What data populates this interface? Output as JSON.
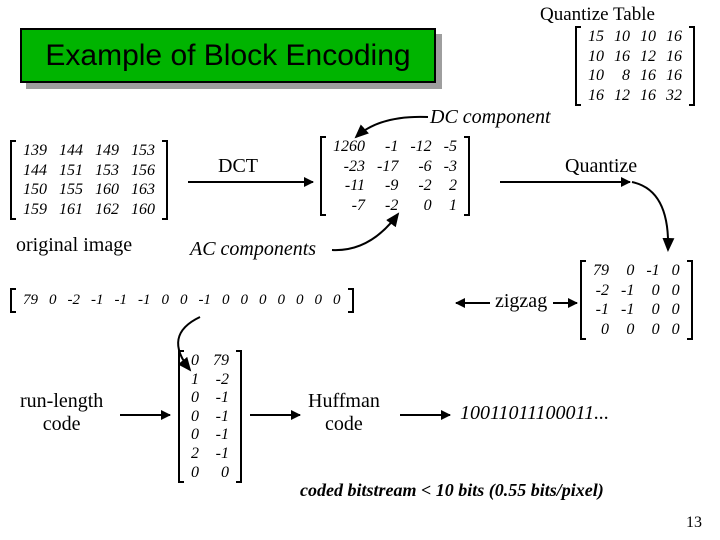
{
  "title": "Example of Block Encoding",
  "labels": {
    "quantize_table": "Quantize Table",
    "dc_component": "DC component",
    "dct": "DCT",
    "quantize": "Quantize",
    "original_image": "original image",
    "ac_components": "AC components",
    "zigzag": "zigzag",
    "run_length_code": "run-length\ncode",
    "huffman_code": "Huffman\ncode",
    "bitstream": "10011011100011...",
    "caption": "coded bitstream < 10 bits (0.55 bits/pixel)"
  },
  "page_number": "13",
  "matrices": {
    "quantize_table": [
      [
        "15",
        "10",
        "10",
        "16"
      ],
      [
        "10",
        "16",
        "12",
        "16"
      ],
      [
        "10",
        "8",
        "16",
        "16"
      ],
      [
        "16",
        "12",
        "16",
        "32"
      ]
    ],
    "original": [
      [
        "139",
        "144",
        "149",
        "153"
      ],
      [
        "144",
        "151",
        "153",
        "156"
      ],
      [
        "150",
        "155",
        "160",
        "163"
      ],
      [
        "159",
        "161",
        "162",
        "160"
      ]
    ],
    "dct_out": [
      [
        "1260",
        "-1",
        "-12",
        "-5"
      ],
      [
        "-23",
        "-17",
        "-6",
        "-3"
      ],
      [
        "-11",
        "-9",
        "-2",
        "2"
      ],
      [
        "-7",
        "-2",
        "0",
        "1"
      ]
    ],
    "quantized": [
      [
        "79",
        "0",
        "-1",
        "0"
      ],
      [
        "-2",
        "-1",
        "0",
        "0"
      ],
      [
        "-1",
        "-1",
        "0",
        "0"
      ],
      [
        "0",
        "0",
        "0",
        "0"
      ]
    ],
    "zigzag_row": [
      [
        "79",
        "0",
        "-2",
        "-1",
        "-1",
        "-1",
        "0",
        "0",
        "-1",
        "0",
        "0",
        "0",
        "0",
        "0",
        "0",
        "0"
      ]
    ],
    "run_length": [
      [
        "0",
        "79"
      ],
      [
        "1",
        "-2"
      ],
      [
        "0",
        "-1"
      ],
      [
        "0",
        "-1"
      ],
      [
        "0",
        "-1"
      ],
      [
        "2",
        "-1"
      ],
      [
        "0",
        "0"
      ]
    ]
  },
  "chart_data": {
    "type": "table",
    "title": "JPEG 4×4 Block Encoding Pipeline",
    "steps": [
      "Original image block",
      "DCT",
      "Quantize (with Quantize Table)",
      "Zigzag scan",
      "Run-length code",
      "Huffman code → bitstream"
    ],
    "original_block": [
      [
        139,
        144,
        149,
        153
      ],
      [
        144,
        151,
        153,
        156
      ],
      [
        150,
        155,
        160,
        163
      ],
      [
        159,
        161,
        162,
        160
      ]
    ],
    "dct_coefficients": [
      [
        1260,
        -1,
        -12,
        -5
      ],
      [
        -23,
        -17,
        -6,
        -3
      ],
      [
        -11,
        -9,
        -2,
        2
      ],
      [
        -7,
        -2,
        0,
        1
      ]
    ],
    "quantize_table": [
      [
        15,
        10,
        10,
        16
      ],
      [
        10,
        16,
        12,
        16
      ],
      [
        10,
        8,
        16,
        16
      ],
      [
        16,
        12,
        16,
        32
      ]
    ],
    "quantized_block": [
      [
        79,
        0,
        -1,
        0
      ],
      [
        -2,
        -1,
        0,
        0
      ],
      [
        -1,
        -1,
        0,
        0
      ],
      [
        0,
        0,
        0,
        0
      ]
    ],
    "dc_component": 79,
    "zigzag_sequence": [
      79,
      0,
      -2,
      -1,
      -1,
      -1,
      0,
      0,
      -1,
      0,
      0,
      0,
      0,
      0,
      0,
      0
    ],
    "run_length_pairs": [
      [
        0,
        79
      ],
      [
        1,
        -2
      ],
      [
        0,
        -1
      ],
      [
        0,
        -1
      ],
      [
        0,
        -1
      ],
      [
        2,
        -1
      ],
      [
        0,
        0
      ]
    ],
    "huffman_bitstream_prefix": "10011011100011",
    "coded_bits_per_block": 10,
    "bits_per_pixel": 0.55
  }
}
